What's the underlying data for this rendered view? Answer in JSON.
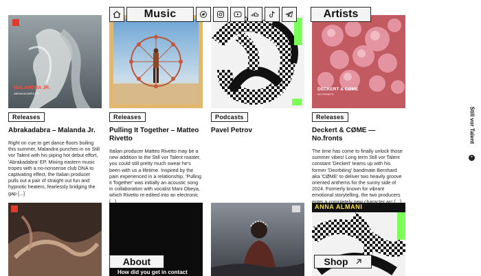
{
  "nav": {
    "music_label": "Music",
    "artists_label": "Artists",
    "social_icons": [
      "bandcamp-icon",
      "instagram-icon",
      "youtube-icon",
      "soundcloud-icon",
      "tiktok-icon",
      "telegram-icon"
    ]
  },
  "side_label": "Still vor Talent",
  "cards": [
    {
      "tag": "Releases",
      "title": "Abrakadabra – Malanda Jr.",
      "body": "Right on cue to get dance floors boiling this summer, Malandra punches in on Still vor Talent with his piping hot debut effort, 'Abrakadabra' EP. Mixing eastern music tropes with a no-nonsense club DNA to captivating effect, the Italian producer pulls out a pair of straight out fun and hypnotic heaters, fearlessly bridging the gap [...]",
      "image_caption": "MALANDRA JR."
    },
    {
      "tag": "Releases",
      "title": "Pulling It Together – Matteo Rivetto",
      "body": "Italian producer Matteo Rivetto may be a new addition to the Still vor Talent roaster, you could still pretty much swear he's been with us a lifetime. Inspired by the pain experienced in a relationship, 'Pulling it Together' was initially an acoustic song in collaboration with vocalist Mani Obeya, which Rivetto re-edited into an electronic [...]"
    },
    {
      "tag": "Podcasts",
      "title": "Pavel Petrov",
      "body": ""
    },
    {
      "tag": "Releases",
      "title": "Deckert & CØME — No.fronts",
      "body": "The time has come to finally unlock those summer vibes! Long term Still vor Talent constant 'Deckert' teams up with his former 'Deorbiting' bandmate Bernhard aka 'CØME' to deliver two heavily groove oriented anthems for the sunny side of 2024. Formerly known for vibrant emotional storytelling, the two producers enter a completely new character arc [...]",
      "image_caption": "DECKERT & CØME"
    }
  ],
  "bottom": {
    "about_label": "About",
    "about_text": "How did you get in contact",
    "shop_label": "Shop",
    "anna_label": "ANNA ALMANI"
  },
  "colors": {
    "accent_green": "#7dff5a",
    "pink": "#e89aa8"
  }
}
